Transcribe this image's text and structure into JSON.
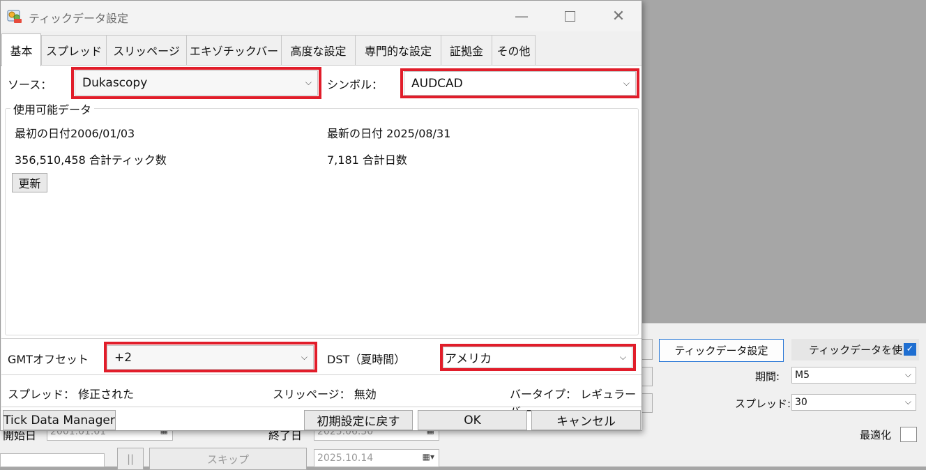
{
  "background": {
    "tick_settings_button": "ティックデータ設定",
    "use_tick_data_label": "ティックデータを使う",
    "use_tick_data_checked": true,
    "period_label": "期間:",
    "period_value": "M5",
    "spread_label": "スプレッド:",
    "spread_value": "30",
    "optimize_label": "最適化",
    "start_label": "開始日",
    "start_value": "2001.01.01",
    "end_label": "終了日",
    "end_value": "2025.06.30",
    "skip_button": "スキップ",
    "skip_date": "2025.10.14",
    "pause_button": "||"
  },
  "dialog": {
    "title": "ティックデータ設定",
    "tabs": [
      "基本",
      "スプレッド",
      "スリッページ",
      "エキゾチックバー",
      "高度な設定",
      "専門的な設定",
      "証拠金",
      "その他"
    ],
    "active_tab": "基本",
    "source_label": "ソース：",
    "source_value": "Dukascopy",
    "symbol_label": "シンボル：",
    "symbol_value": "AUDCAD",
    "group_title": "使用可能データ",
    "first_date": "最初の日付2006/01/03",
    "last_date": "最新の日付 2025/08/31",
    "total_ticks": "356,510,458 合計ティック数",
    "total_days": "7,181 合計日数",
    "refresh_button": "更新",
    "gmt_label": "GMTオフセット",
    "gmt_value": "+2",
    "dst_label": "DST（夏時間）",
    "dst_value": "アメリカ",
    "spread_status": "スプレッド：  修正された",
    "slippage_status": "スリッページ：  無効",
    "bartype_status": "バータイプ：  レギュラーバー",
    "tick_manager_button": "Tick Data Manager",
    "reset_button": "初期設定に戻す",
    "ok_button": "OK",
    "cancel_button": "キャンセル",
    "highlight_color": "#e11d2a"
  }
}
